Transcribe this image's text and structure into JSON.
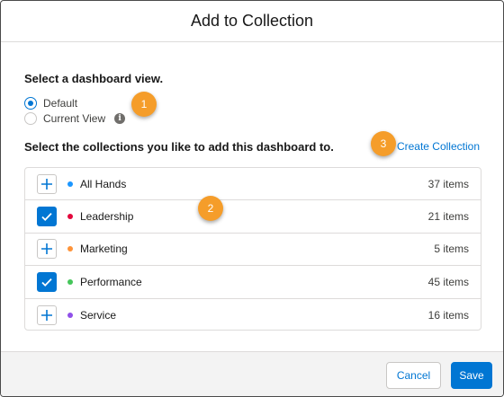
{
  "dialog": {
    "title": "Add to Collection"
  },
  "view_section": {
    "heading": "Select a dashboard view.",
    "options": [
      {
        "label": "Default",
        "selected": true
      },
      {
        "label": "Current View",
        "selected": false,
        "info_icon": "info-icon"
      }
    ]
  },
  "collections_section": {
    "heading": "Select the collections you like to add this dashboard to.",
    "create_link": "Create Collection",
    "items": [
      {
        "label": "All Hands",
        "count": "37 items",
        "checked": false,
        "dot_color": "#1b96ff"
      },
      {
        "label": "Leadership",
        "count": "21 items",
        "checked": true,
        "dot_color": "#e3073c"
      },
      {
        "label": "Marketing",
        "count": "5 items",
        "checked": false,
        "dot_color": "#fe9339"
      },
      {
        "label": "Performance",
        "count": "45 items",
        "checked": true,
        "dot_color": "#45c65a"
      },
      {
        "label": "Service",
        "count": "16 items",
        "checked": false,
        "dot_color": "#9050e9"
      }
    ]
  },
  "callouts": [
    "1",
    "2",
    "3"
  ],
  "footer": {
    "cancel_label": "Cancel",
    "save_label": "Save"
  },
  "colors": {
    "accent": "#0176d3",
    "callout": "#f59d2a"
  }
}
